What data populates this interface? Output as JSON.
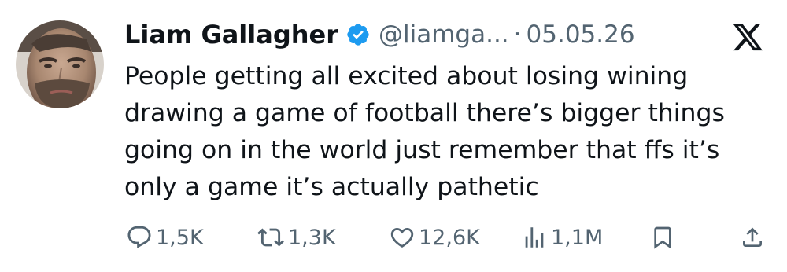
{
  "tweet": {
    "author_name": "Liam Gallagher",
    "handle": "@liamga...",
    "separator": "·",
    "date": "05.05.26",
    "text_lines": [
      "People getting all excited about losing wining",
      "drawing a game of football there’s bigger things",
      "going on in the world just remember that ffs it’s",
      "only a game it’s actually pathetic"
    ]
  },
  "actions": {
    "reply_count": "1,5K",
    "repost_count": "1,3K",
    "like_count": "12,6K",
    "views_count": "1,1M"
  },
  "icons": {
    "verified": "verified-badge-icon",
    "logo": "x-logo-icon",
    "reply": "reply-icon",
    "repost": "repost-icon",
    "like": "heart-icon",
    "views": "views-icon",
    "bookmark": "bookmark-icon",
    "share": "share-icon"
  },
  "colors": {
    "text": "#0f1419",
    "secondary": "#536471",
    "verified_blue": "#1d9bf0"
  }
}
